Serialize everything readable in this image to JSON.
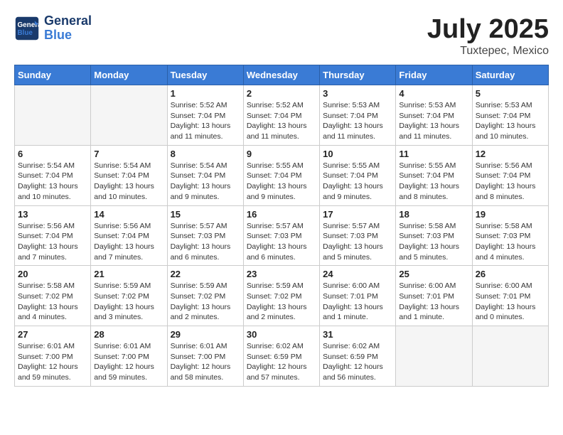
{
  "logo": {
    "text_general": "General",
    "text_blue": "Blue"
  },
  "title": "July 2025",
  "subtitle": "Tuxtepec, Mexico",
  "days_of_week": [
    "Sunday",
    "Monday",
    "Tuesday",
    "Wednesday",
    "Thursday",
    "Friday",
    "Saturday"
  ],
  "weeks": [
    [
      {
        "day": "",
        "info": ""
      },
      {
        "day": "",
        "info": ""
      },
      {
        "day": "1",
        "info": "Sunrise: 5:52 AM\nSunset: 7:04 PM\nDaylight: 13 hours and 11 minutes."
      },
      {
        "day": "2",
        "info": "Sunrise: 5:52 AM\nSunset: 7:04 PM\nDaylight: 13 hours and 11 minutes."
      },
      {
        "day": "3",
        "info": "Sunrise: 5:53 AM\nSunset: 7:04 PM\nDaylight: 13 hours and 11 minutes."
      },
      {
        "day": "4",
        "info": "Sunrise: 5:53 AM\nSunset: 7:04 PM\nDaylight: 13 hours and 11 minutes."
      },
      {
        "day": "5",
        "info": "Sunrise: 5:53 AM\nSunset: 7:04 PM\nDaylight: 13 hours and 10 minutes."
      }
    ],
    [
      {
        "day": "6",
        "info": "Sunrise: 5:54 AM\nSunset: 7:04 PM\nDaylight: 13 hours and 10 minutes."
      },
      {
        "day": "7",
        "info": "Sunrise: 5:54 AM\nSunset: 7:04 PM\nDaylight: 13 hours and 10 minutes."
      },
      {
        "day": "8",
        "info": "Sunrise: 5:54 AM\nSunset: 7:04 PM\nDaylight: 13 hours and 9 minutes."
      },
      {
        "day": "9",
        "info": "Sunrise: 5:55 AM\nSunset: 7:04 PM\nDaylight: 13 hours and 9 minutes."
      },
      {
        "day": "10",
        "info": "Sunrise: 5:55 AM\nSunset: 7:04 PM\nDaylight: 13 hours and 9 minutes."
      },
      {
        "day": "11",
        "info": "Sunrise: 5:55 AM\nSunset: 7:04 PM\nDaylight: 13 hours and 8 minutes."
      },
      {
        "day": "12",
        "info": "Sunrise: 5:56 AM\nSunset: 7:04 PM\nDaylight: 13 hours and 8 minutes."
      }
    ],
    [
      {
        "day": "13",
        "info": "Sunrise: 5:56 AM\nSunset: 7:04 PM\nDaylight: 13 hours and 7 minutes."
      },
      {
        "day": "14",
        "info": "Sunrise: 5:56 AM\nSunset: 7:04 PM\nDaylight: 13 hours and 7 minutes."
      },
      {
        "day": "15",
        "info": "Sunrise: 5:57 AM\nSunset: 7:03 PM\nDaylight: 13 hours and 6 minutes."
      },
      {
        "day": "16",
        "info": "Sunrise: 5:57 AM\nSunset: 7:03 PM\nDaylight: 13 hours and 6 minutes."
      },
      {
        "day": "17",
        "info": "Sunrise: 5:57 AM\nSunset: 7:03 PM\nDaylight: 13 hours and 5 minutes."
      },
      {
        "day": "18",
        "info": "Sunrise: 5:58 AM\nSunset: 7:03 PM\nDaylight: 13 hours and 5 minutes."
      },
      {
        "day": "19",
        "info": "Sunrise: 5:58 AM\nSunset: 7:03 PM\nDaylight: 13 hours and 4 minutes."
      }
    ],
    [
      {
        "day": "20",
        "info": "Sunrise: 5:58 AM\nSunset: 7:02 PM\nDaylight: 13 hours and 4 minutes."
      },
      {
        "day": "21",
        "info": "Sunrise: 5:59 AM\nSunset: 7:02 PM\nDaylight: 13 hours and 3 minutes."
      },
      {
        "day": "22",
        "info": "Sunrise: 5:59 AM\nSunset: 7:02 PM\nDaylight: 13 hours and 2 minutes."
      },
      {
        "day": "23",
        "info": "Sunrise: 5:59 AM\nSunset: 7:02 PM\nDaylight: 13 hours and 2 minutes."
      },
      {
        "day": "24",
        "info": "Sunrise: 6:00 AM\nSunset: 7:01 PM\nDaylight: 13 hours and 1 minute."
      },
      {
        "day": "25",
        "info": "Sunrise: 6:00 AM\nSunset: 7:01 PM\nDaylight: 13 hours and 1 minute."
      },
      {
        "day": "26",
        "info": "Sunrise: 6:00 AM\nSunset: 7:01 PM\nDaylight: 13 hours and 0 minutes."
      }
    ],
    [
      {
        "day": "27",
        "info": "Sunrise: 6:01 AM\nSunset: 7:00 PM\nDaylight: 12 hours and 59 minutes."
      },
      {
        "day": "28",
        "info": "Sunrise: 6:01 AM\nSunset: 7:00 PM\nDaylight: 12 hours and 59 minutes."
      },
      {
        "day": "29",
        "info": "Sunrise: 6:01 AM\nSunset: 7:00 PM\nDaylight: 12 hours and 58 minutes."
      },
      {
        "day": "30",
        "info": "Sunrise: 6:02 AM\nSunset: 6:59 PM\nDaylight: 12 hours and 57 minutes."
      },
      {
        "day": "31",
        "info": "Sunrise: 6:02 AM\nSunset: 6:59 PM\nDaylight: 12 hours and 56 minutes."
      },
      {
        "day": "",
        "info": ""
      },
      {
        "day": "",
        "info": ""
      }
    ]
  ]
}
